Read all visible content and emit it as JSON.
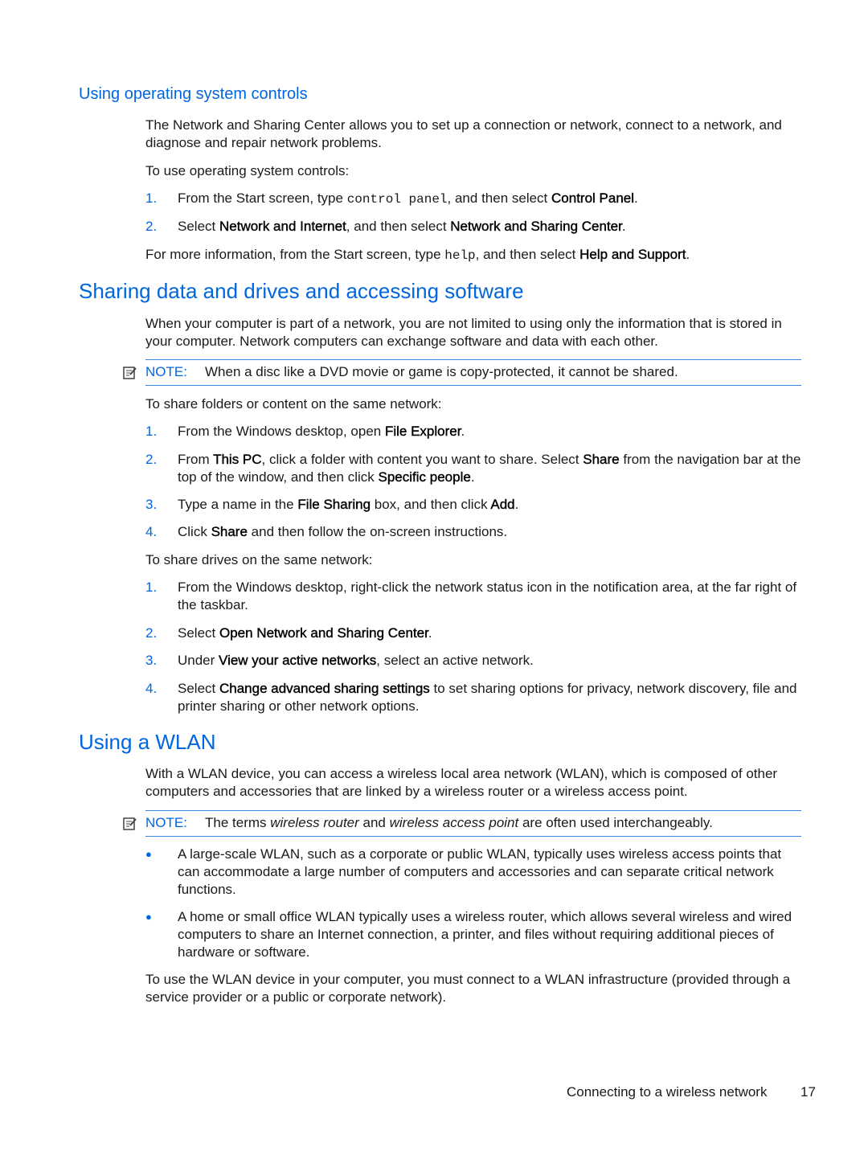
{
  "sections": {
    "os_controls": {
      "heading": "Using operating system controls",
      "intro": "The Network and Sharing Center allows you to set up a connection or network, connect to a network, and diagnose and repair network problems.",
      "lead": "To use operating system controls:",
      "steps": [
        {
          "num": "1.",
          "pre": "From the Start screen, type ",
          "code": "control panel",
          "mid": ", and then select ",
          "bold": "Control Panel",
          "post": "."
        },
        {
          "num": "2.",
          "pre": "Select ",
          "bold1": "Network and Internet",
          "mid": ", and then select ",
          "bold2": "Network and Sharing Center",
          "post": "."
        }
      ],
      "more": {
        "pre": "For more information, from the Start screen, type ",
        "code": "help",
        "mid": ", and then select ",
        "bold": "Help and Support",
        "post": "."
      }
    },
    "sharing": {
      "heading": "Sharing data and drives and accessing software",
      "intro": "When your computer is part of a network, you are not limited to using only the information that is stored in your computer. Network computers can exchange software and data with each other.",
      "note_label": "NOTE:",
      "note_text": "When a disc like a DVD movie or game is copy-protected, it cannot be shared.",
      "folders_lead": "To share folders or content on the same network:",
      "folder_steps": [
        {
          "num": "1.",
          "html": "From the Windows desktop, open <b>File Explorer</b>."
        },
        {
          "num": "2.",
          "html": "From <b>This PC</b>, click a folder with content you want to share. Select <b>Share</b> from the navigation bar at the top of the window, and then click <b>Specific people</b>."
        },
        {
          "num": "3.",
          "html": "Type a name in the <b>File Sharing</b> box, and then click <b>Add</b>."
        },
        {
          "num": "4.",
          "html": "Click <b>Share</b> and then follow the on-screen instructions."
        }
      ],
      "drives_lead": "To share drives on the same network:",
      "drive_steps": [
        {
          "num": "1.",
          "html": "From the Windows desktop, right-click the network status icon in the notification area, at the far right of the taskbar."
        },
        {
          "num": "2.",
          "html": "Select <b>Open Network and Sharing Center</b>."
        },
        {
          "num": "3.",
          "html": "Under <b>View your active networks</b>, select an active network."
        },
        {
          "num": "4.",
          "html": "Select <b>Change advanced sharing settings</b> to set sharing options for privacy, network discovery, file and printer sharing or other network options."
        }
      ]
    },
    "wlan": {
      "heading": "Using a WLAN",
      "intro": "With a WLAN device, you can access a wireless local area network (WLAN), which is composed of other computers and accessories that are linked by a wireless router or a wireless access point.",
      "note_label": "NOTE:",
      "note_html": "The terms <i>wireless router</i> and <i>wireless access point</i> are often used interchangeably.",
      "bullets": [
        "A large-scale WLAN, such as a corporate or public WLAN, typically uses wireless access points that can accommodate a large number of computers and accessories and can separate critical network functions.",
        "A home or small office WLAN typically uses a wireless router, which allows several wireless and wired computers to share an Internet connection, a printer, and files without requiring additional pieces of hardware or software."
      ],
      "closing": "To use the WLAN device in your computer, you must connect to a WLAN infrastructure (provided through a service provider or a public or corporate network)."
    }
  },
  "footer": {
    "chapter": "Connecting to a wireless network",
    "page": "17"
  },
  "colors": {
    "accent": "#0066e0"
  }
}
